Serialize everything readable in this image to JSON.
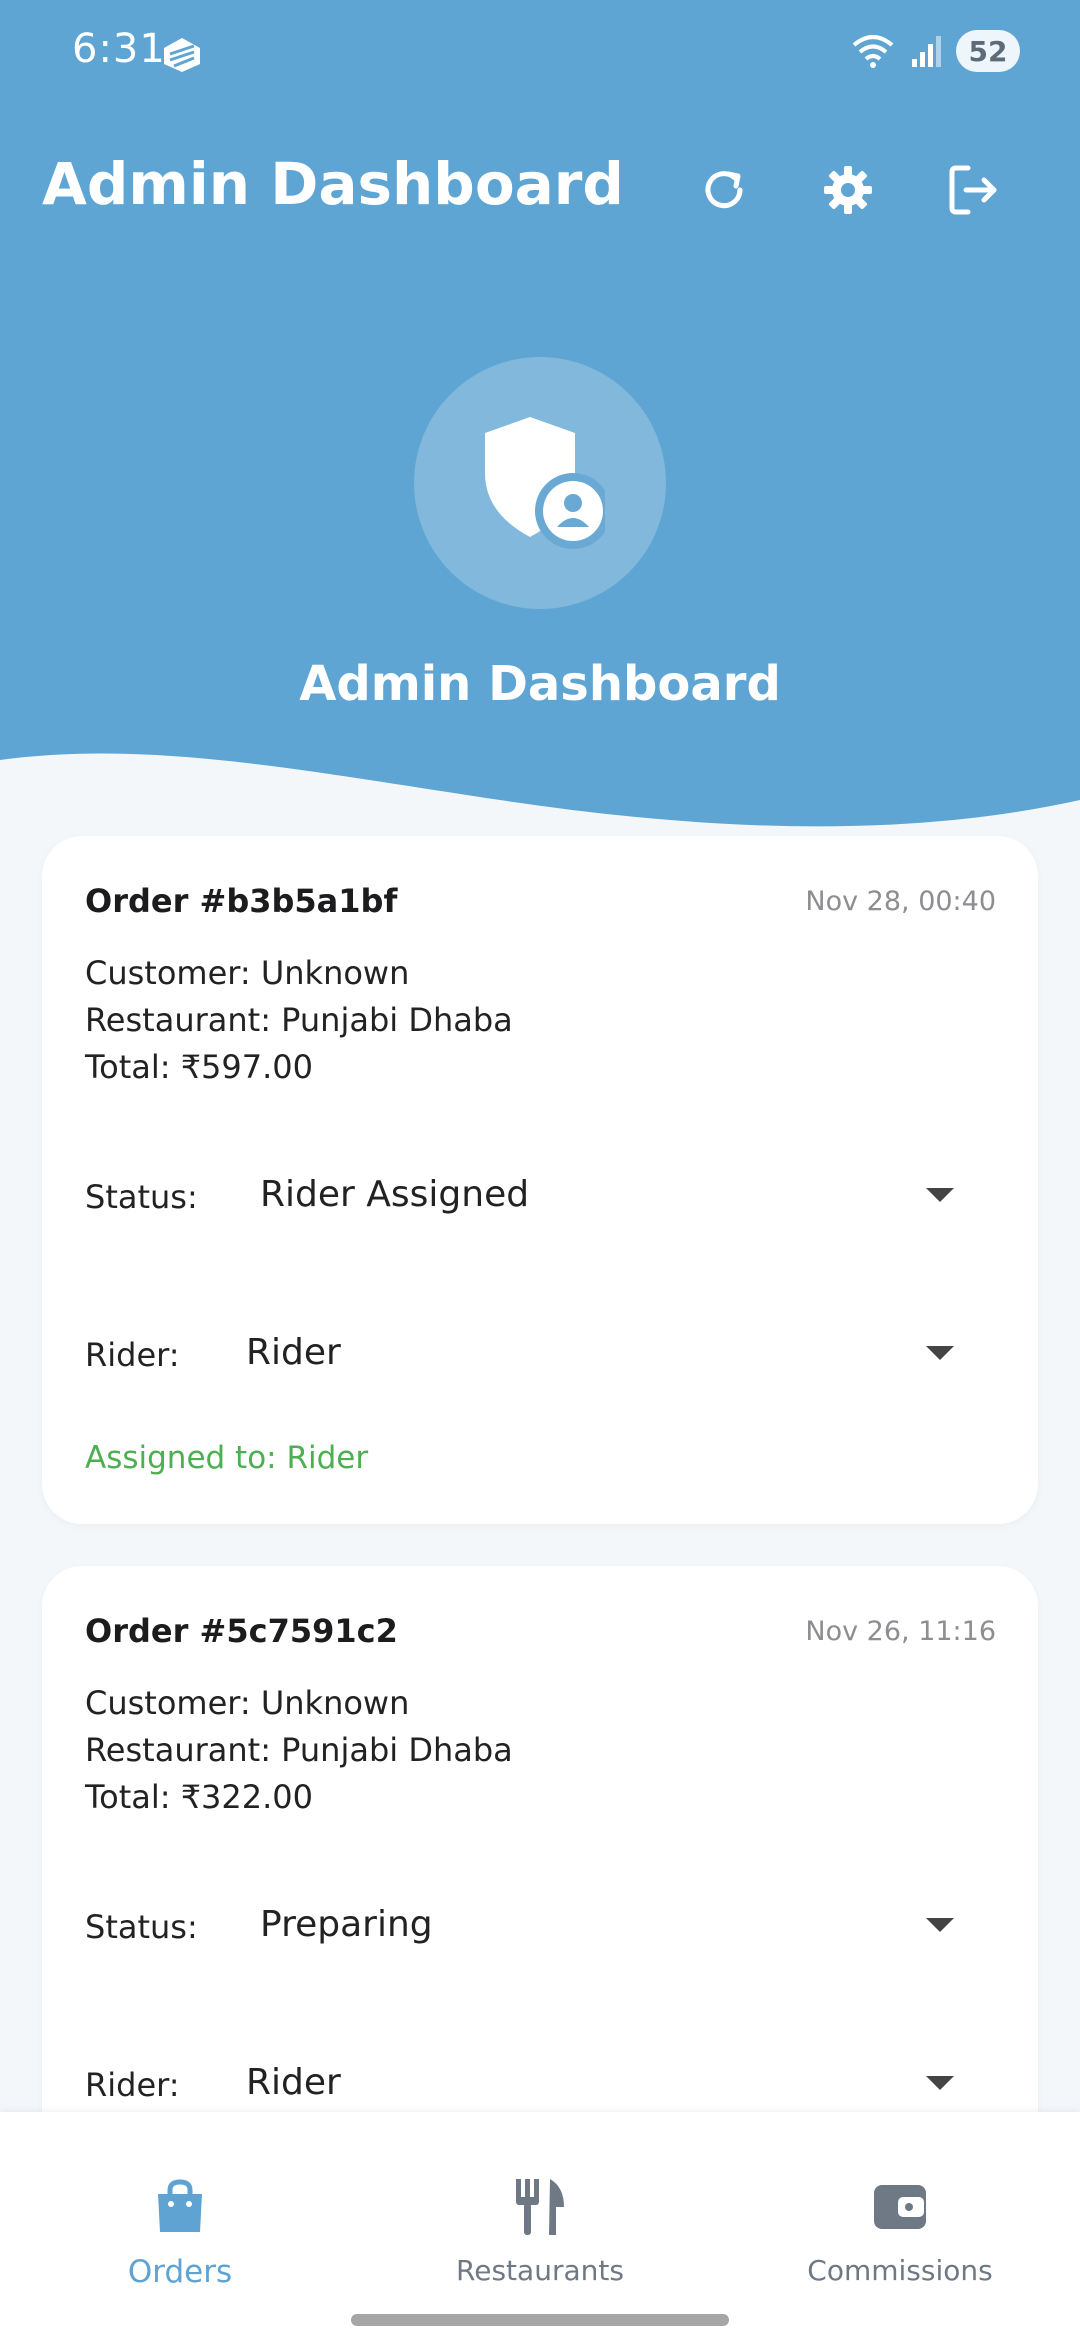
{
  "status_bar": {
    "time": "6:31",
    "battery": "52"
  },
  "topbar": {
    "title": "Admin Dashboard"
  },
  "hero": {
    "title": "Admin Dashboard"
  },
  "orders": [
    {
      "order_id": "Order #b3b5a1bf",
      "date": "Nov 28, 00:40",
      "customer": "Customer: Unknown",
      "restaurant": "Restaurant: Punjabi Dhaba",
      "total": "Total: ₹597.00",
      "status_label": "Status:",
      "status_value": "Rider Assigned",
      "rider_label": "Rider:",
      "rider_value": "Rider",
      "assigned_text": "Assigned to: Rider"
    },
    {
      "order_id": "Order #5c7591c2",
      "date": "Nov 26, 11:16",
      "customer": "Customer: Unknown",
      "restaurant": "Restaurant: Punjabi Dhaba",
      "total": "Total: ₹322.00",
      "status_label": "Status:",
      "status_value": "Preparing",
      "rider_label": "Rider:",
      "rider_value": "Rider"
    }
  ],
  "bottom_nav": [
    {
      "label": "Orders",
      "icon": "shopping-bag-icon",
      "active": true
    },
    {
      "label": "Restaurants",
      "icon": "fork-knife-icon",
      "active": false
    },
    {
      "label": "Commissions",
      "icon": "wallet-icon",
      "active": false
    }
  ],
  "colors": {
    "header_blue": "#5ea5d3",
    "accent_blue": "#5fa3d2",
    "success_green": "#4caf50",
    "background": "#f3f7fa",
    "nav_inactive": "#6f7885"
  }
}
